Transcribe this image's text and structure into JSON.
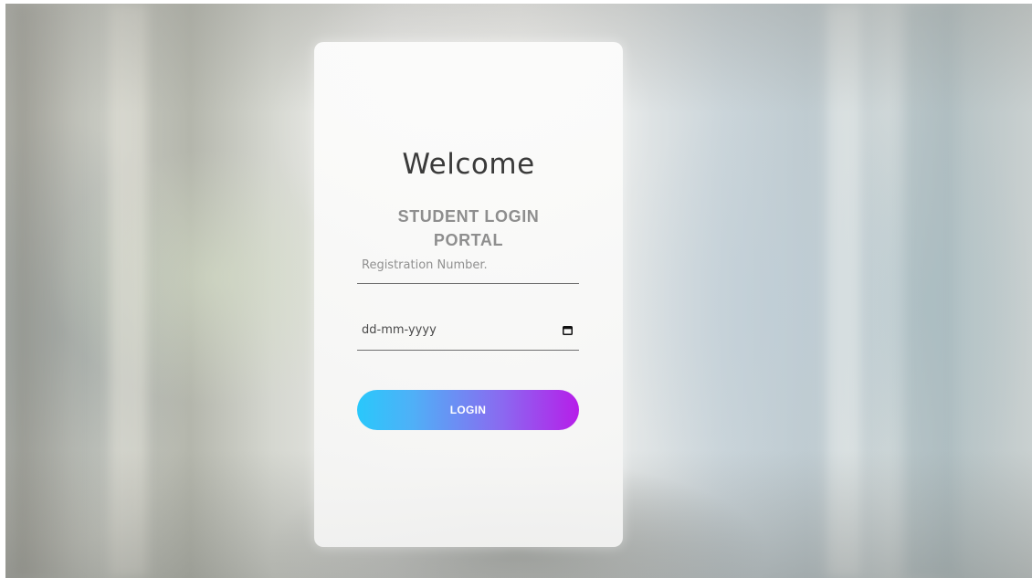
{
  "card": {
    "title": "Welcome",
    "subtitle_line1": "STUDENT LOGIN",
    "subtitle_line2": "PORTAL"
  },
  "form": {
    "registration": {
      "placeholder": "Registration Number.",
      "value": ""
    },
    "date": {
      "value": "dd-mm-yyyy",
      "icon": "calendar-icon"
    },
    "login_label": "LOGIN"
  },
  "colors": {
    "button_gradient_start": "#29c8fb",
    "button_gradient_end": "#b61ee9",
    "title_color": "#3a3a3a",
    "subtitle_color": "#8e8e8e"
  }
}
